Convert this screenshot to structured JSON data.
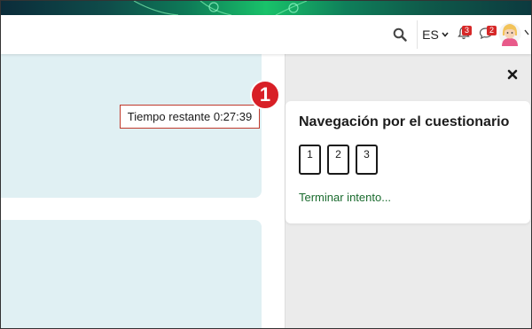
{
  "header": {
    "language": "ES",
    "notifications_count": "3",
    "messages_count": "2"
  },
  "quiz": {
    "timer_text": "Tiempo restante 0:27:39",
    "marker_number": "1"
  },
  "drawer": {
    "title": "Navegación por el cuestionario",
    "questions": [
      "1",
      "2",
      "3"
    ],
    "finish_label": "Terminar intento..."
  },
  "colors": {
    "card_bg": "#e0f0f3",
    "drawer_bg": "#ebebeb",
    "marker_red": "#d81f26",
    "finish_green": "#1a6b2e",
    "badge_red": "#d62828"
  },
  "icons": [
    "search-icon",
    "chevron-down-icon",
    "bell-icon",
    "chat-icon",
    "avatar",
    "close-icon"
  ]
}
